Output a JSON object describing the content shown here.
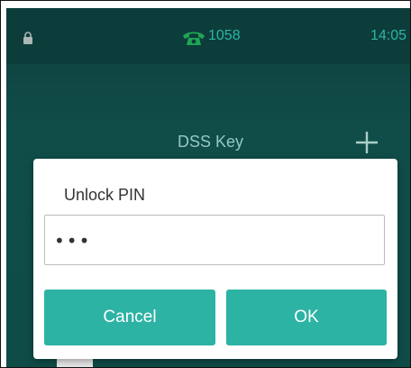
{
  "statusbar": {
    "extension": "1058",
    "time": "14:05",
    "lock_icon": "lock-icon",
    "phone_icon": "phone-icon",
    "accent_color": "#2bb6a7"
  },
  "background": {
    "title": "DSS Key",
    "add_icon": "plus-icon"
  },
  "dialog": {
    "title": "Unlock PIN",
    "pin_value": "•••",
    "cancel_label": "Cancel",
    "ok_label": "OK",
    "button_color": "#2db3a4"
  }
}
